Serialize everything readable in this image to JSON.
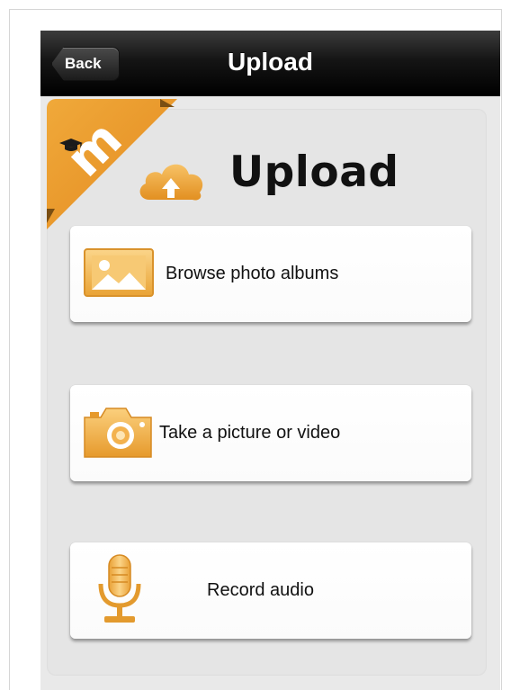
{
  "navbar": {
    "back_label": "Back",
    "title": "Upload"
  },
  "header": {
    "title": "Upload",
    "icon": "cloud-upload-icon"
  },
  "actions": [
    {
      "label": "Browse photo albums",
      "icon": "photo-icon"
    },
    {
      "label": "Take a picture or video",
      "icon": "camera-icon"
    },
    {
      "label": "Record audio",
      "icon": "microphone-icon"
    }
  ],
  "brand": {
    "logo_letter": "m",
    "accent_color": "#f0a93a"
  }
}
